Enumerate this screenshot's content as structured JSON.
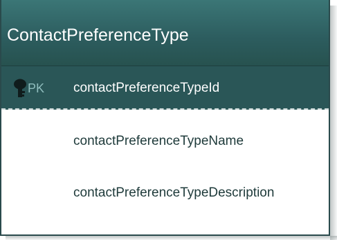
{
  "entity": {
    "name": "ContactPreferenceType",
    "primary_key": {
      "badge": "PK",
      "icon": "key-icon",
      "name": "contactPreferenceTypeId"
    },
    "attributes": [
      {
        "name": "contactPreferenceTypeName"
      },
      {
        "name": "contactPreferenceTypeDescription"
      }
    ]
  },
  "colors": {
    "header": "#2c5c5e",
    "pk_row": "#2a5657",
    "text_dark": "#1e3a3a",
    "pk_badge": "#8fbdbd"
  }
}
